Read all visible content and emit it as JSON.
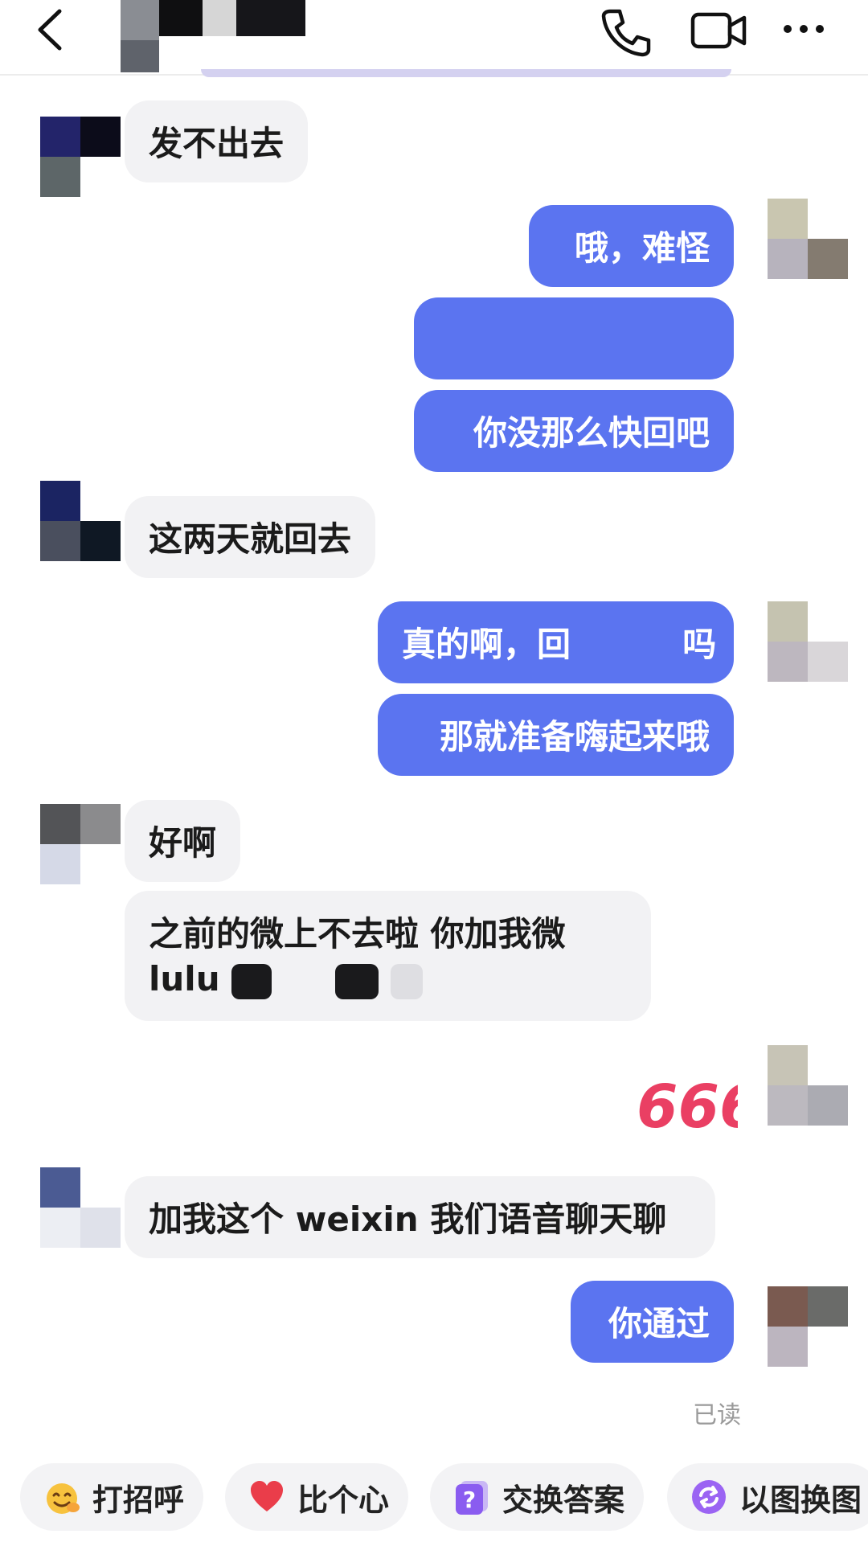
{
  "header": {
    "back_icon": "chevron-left-icon",
    "call_icon": "phone-icon",
    "video_icon": "video-camera-icon",
    "more_icon": "more-dots-icon"
  },
  "messages": [
    {
      "side": "in",
      "text": "发不出去"
    },
    {
      "side": "out",
      "text": "哦，难怪"
    },
    {
      "side": "out",
      "text": ""
    },
    {
      "side": "out",
      "text": "你没那么快回吧"
    },
    {
      "side": "in",
      "text": "这两天就回去"
    },
    {
      "side": "out",
      "text_before": "真的啊，回",
      "text_after": "吗"
    },
    {
      "side": "out",
      "text": "那就准备嗨起来哦"
    },
    {
      "side": "in",
      "text": "好啊"
    },
    {
      "side": "in",
      "line1": "之前的微上不去啦 你加我微",
      "line2": "lulu"
    },
    {
      "side": "out",
      "sticker": "666-sticker"
    },
    {
      "side": "in",
      "text": "加我这个 weixin 我们语音聊天聊"
    },
    {
      "side": "out",
      "text": "你通过"
    }
  ],
  "read_status": "已读",
  "quick_replies": [
    {
      "label": "打招呼",
      "icon": "waving-hand-emoji-icon"
    },
    {
      "label": "比个心",
      "icon": "heart-icon"
    },
    {
      "label": "交换答案",
      "icon": "question-card-icon"
    },
    {
      "label": "以图换图",
      "icon": "image-swap-icon"
    }
  ],
  "colors": {
    "outgoing_bubble": "#5b74f0",
    "incoming_bubble": "#f2f2f4",
    "read_text": "#9a9a9a"
  }
}
